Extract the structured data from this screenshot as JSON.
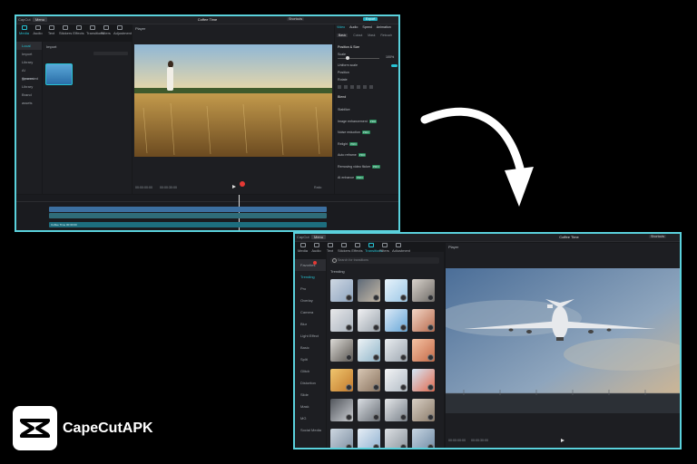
{
  "window1": {
    "app_label": "CapCut",
    "menu_label": "Menu",
    "title": "Coffee Time",
    "shortcuts_label": "Shortcuts",
    "export_label": "Export",
    "toolbar": [
      {
        "label": "Media",
        "active": true
      },
      {
        "label": "Audio",
        "active": false
      },
      {
        "label": "Text",
        "active": false
      },
      {
        "label": "Stickers",
        "active": false
      },
      {
        "label": "Effects",
        "active": false
      },
      {
        "label": "Transitions",
        "active": false
      },
      {
        "label": "Filters",
        "active": false
      },
      {
        "label": "Adjustment",
        "active": false
      }
    ],
    "sidebar": [
      "Local",
      "Import",
      "Library",
      "AI generated",
      "Spaces",
      "Library",
      "Brand assets"
    ],
    "import_label": "Import",
    "player_label": "Player",
    "properties_tabs": [
      "Video",
      "Audio",
      "Speed",
      "Animation"
    ],
    "properties_subtabs": [
      "Basic",
      "Cutout",
      "Mask",
      "Retouch"
    ],
    "section_title": "Position & Size",
    "scale_label": "Scale",
    "scale_value": "100%",
    "uniform_scale_label": "Uniform scale",
    "position_label": "Position",
    "rotate_label": "Rotate",
    "blend_label": "Blend",
    "features": [
      {
        "label": "Stabilize",
        "pro": false
      },
      {
        "label": "Image enhancement",
        "pro": true
      },
      {
        "label": "Noise reduction",
        "pro": true
      },
      {
        "label": "Relight",
        "pro": true
      },
      {
        "label": "Auto reframe",
        "pro": true
      },
      {
        "label": "Removing video flicker",
        "pro": true
      },
      {
        "label": "AI enhance",
        "pro": true
      }
    ],
    "timecode": "00:00:00:00",
    "duration": "00:00:30:00",
    "ratio_label": "Ratio",
    "clip_label": "Clip",
    "audio_clip_label": "Coffee Time 00:30:00"
  },
  "window2": {
    "app_label": "CapCut",
    "menu_label": "Menu",
    "title": "Coffee Time",
    "shortcuts_label": "Shortcuts",
    "toolbar": [
      {
        "label": "Media",
        "active": false
      },
      {
        "label": "Audio",
        "active": false
      },
      {
        "label": "Text",
        "active": false
      },
      {
        "label": "Stickers",
        "active": false
      },
      {
        "label": "Effects",
        "active": false
      },
      {
        "label": "Transitions",
        "active": true
      },
      {
        "label": "Filters",
        "active": false
      },
      {
        "label": "Adjustment",
        "active": false
      }
    ],
    "search_placeholder": "Search for transitions",
    "sidebar": [
      {
        "label": "Favorites",
        "active": false
      },
      {
        "label": "Trending",
        "active": true
      },
      {
        "label": "Pro",
        "active": false
      },
      {
        "label": "Overlay",
        "active": false
      },
      {
        "label": "Camera",
        "active": false
      },
      {
        "label": "Blur",
        "active": false
      },
      {
        "label": "Light Effect",
        "active": false
      },
      {
        "label": "Basic",
        "active": false
      },
      {
        "label": "Split",
        "active": false
      },
      {
        "label": "Glitch",
        "active": false
      },
      {
        "label": "Distortion",
        "active": false
      },
      {
        "label": "Slide",
        "active": false
      },
      {
        "label": "Mask",
        "active": false
      },
      {
        "label": "MG",
        "active": false
      },
      {
        "label": "Social Media",
        "active": false
      }
    ],
    "grid_header": "Trending",
    "player_label": "Player",
    "timecode": "00:00:00:00",
    "duration": "00:00:30:00"
  },
  "brand": {
    "name": "CapeCutAPK"
  },
  "colors": {
    "accent": "#27c3d4",
    "frame_border": "#5ad1dc",
    "export": "#21b3c6"
  }
}
